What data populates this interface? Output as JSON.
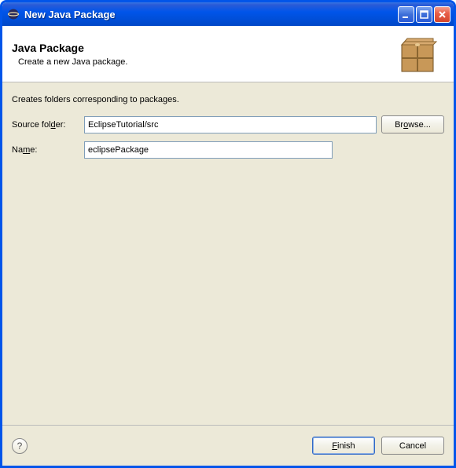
{
  "window": {
    "title": "New Java Package"
  },
  "banner": {
    "title": "Java Package",
    "subtitle": "Create a new Java package."
  },
  "content": {
    "description": "Creates folders corresponding to packages.",
    "source_folder_label_pre": "Source fol",
    "source_folder_label_mn": "d",
    "source_folder_label_post": "er:",
    "source_folder_value": "EclipseTutorial/src",
    "browse_label_pre": "Br",
    "browse_label_mn": "o",
    "browse_label_post": "wse...",
    "name_label_pre": "Na",
    "name_label_mn": "m",
    "name_label_post": "e:",
    "name_value": "eclipsePackage"
  },
  "footer": {
    "help_glyph": "?",
    "finish_label_mn": "F",
    "finish_label_post": "inish",
    "cancel_label": "Cancel"
  }
}
